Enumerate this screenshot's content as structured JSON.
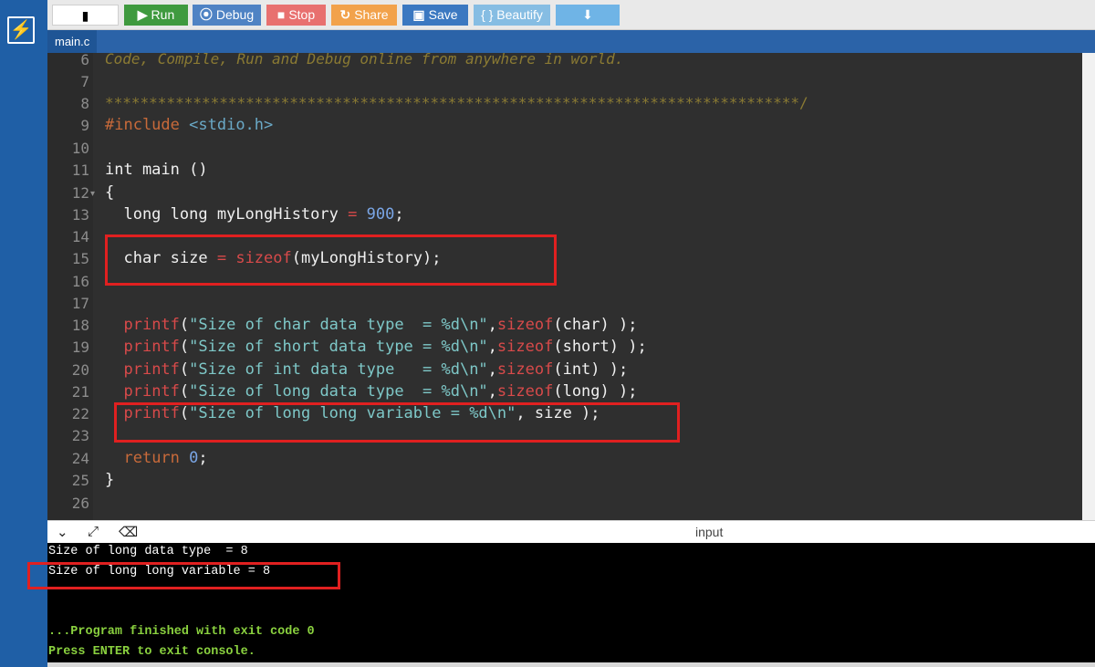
{
  "toolbar": {
    "new_icon": "file-icon",
    "run": "Run",
    "debug": "Debug",
    "stop": "Stop",
    "share": "Share",
    "save": "Save",
    "beautify": "{ } Beautify",
    "download_icon": "download-icon"
  },
  "tabs": {
    "active": "main.c"
  },
  "editor": {
    "lines": [
      {
        "n": "6",
        "text": "Code, Compile, Run and Debug online from anywhere in world."
      },
      {
        "n": "7",
        "text": ""
      },
      {
        "n": "8",
        "text": "*******************************************************************************/"
      },
      {
        "n": "9",
        "text": "#include <stdio.h>"
      },
      {
        "n": "10",
        "text": ""
      },
      {
        "n": "11",
        "text": "int main ()"
      },
      {
        "n": "12",
        "text": "{"
      },
      {
        "n": "13",
        "text": "  long long myLongHistory = 900;"
      },
      {
        "n": "14",
        "text": ""
      },
      {
        "n": "15",
        "text": "  char size = sizeof(myLongHistory);"
      },
      {
        "n": "16",
        "text": ""
      },
      {
        "n": "17",
        "text": ""
      },
      {
        "n": "18",
        "text": "  printf(\"Size of char data type  = %d\\n\",sizeof(char) );"
      },
      {
        "n": "19",
        "text": "  printf(\"Size of short data type = %d\\n\",sizeof(short) );"
      },
      {
        "n": "20",
        "text": "  printf(\"Size of int data type   = %d\\n\",sizeof(int) );"
      },
      {
        "n": "21",
        "text": "  printf(\"Size of long data type  = %d\\n\",sizeof(long) );"
      },
      {
        "n": "22",
        "text": "  printf(\"Size of long long variable = %d\\n\", size );"
      },
      {
        "n": "23",
        "text": ""
      },
      {
        "n": "24",
        "text": "  return 0;"
      },
      {
        "n": "25",
        "text": "}"
      },
      {
        "n": "26",
        "text": ""
      }
    ]
  },
  "console": {
    "input_label": "input",
    "output": [
      "Size of long data type  = 8",
      "Size of long long variable = 8"
    ],
    "finished": "...Program finished with exit code 0",
    "press_enter": "Press ENTER to exit console."
  },
  "colors": {
    "sidebar": "#1f5fa6",
    "editor_bg": "#2f2f2f",
    "highlight_box": "#e02020",
    "run": "#3f9a3f",
    "debug": "#4f83c4",
    "stop": "#e8706f",
    "share": "#f2a24b",
    "save": "#3b78c1"
  }
}
